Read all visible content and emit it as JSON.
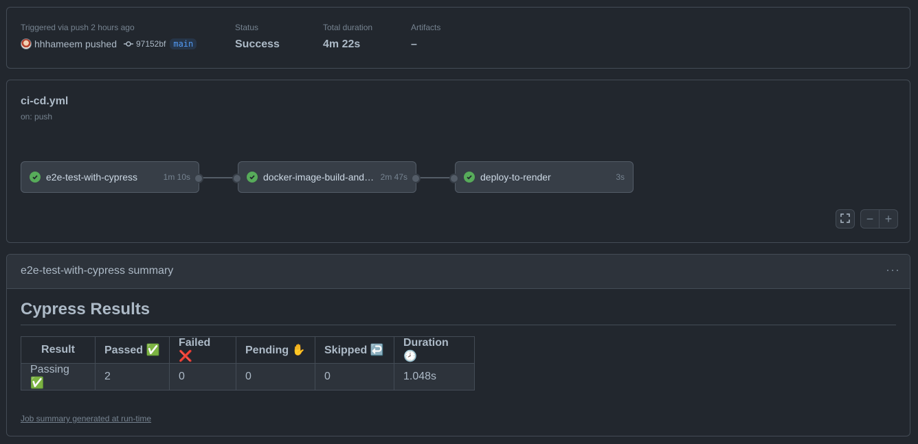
{
  "run": {
    "trigger_label": "Triggered via push 2 hours ago",
    "actor": "hhhameem",
    "action": "pushed",
    "commit_sha": "97152bf",
    "branch": "main",
    "status_label": "Status",
    "status_value": "Success",
    "duration_label": "Total duration",
    "duration_value": "4m 22s",
    "artifacts_label": "Artifacts",
    "artifacts_value": "–"
  },
  "workflow": {
    "file": "ci-cd.yml",
    "trigger": "on: push",
    "jobs": [
      {
        "name": "e2e-test-with-cypress",
        "duration": "1m 10s",
        "status": "success"
      },
      {
        "name": "docker-image-build-and-push",
        "duration": "2m 47s",
        "status": "success"
      },
      {
        "name": "deploy-to-render",
        "duration": "3s",
        "status": "success"
      }
    ],
    "controls": {
      "fullscreen_icon": "fullscreen-icon",
      "zoom_out": "−",
      "zoom_in": "+"
    }
  },
  "job_summary": {
    "header": "e2e-test-with-cypress summary",
    "menu": "···",
    "heading": "Cypress Results",
    "columns": [
      "Result",
      "Passed ✅",
      "Failed ❌",
      "Pending ✋",
      "Skipped ↩️",
      "Duration 🕗"
    ],
    "rows": [
      [
        "Passing ✅",
        "2",
        "0",
        "0",
        "0",
        "1.048s"
      ]
    ],
    "footer": "Job summary generated at run-time"
  },
  "colors": {
    "background": "#22272e",
    "border": "#444c56",
    "success": "#57ab5a",
    "branch": "#539bf5"
  }
}
